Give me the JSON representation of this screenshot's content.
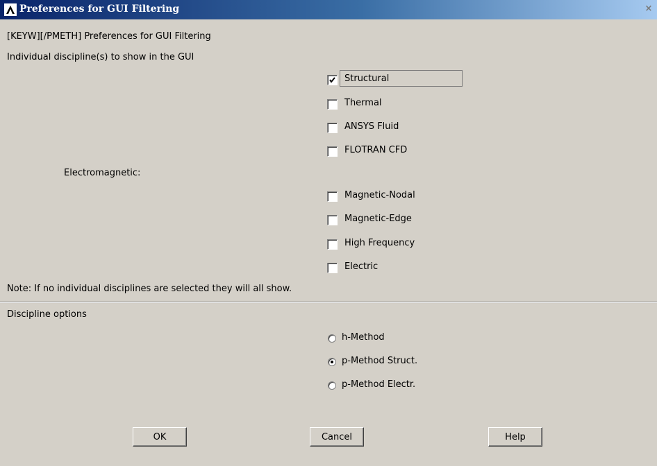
{
  "window": {
    "title": "Preferences for GUI Filtering",
    "close_glyph": "×",
    "logo_icon": "ansys-logo-icon"
  },
  "header": {
    "command": "[KEYW][/PMETH] Preferences for GUI Filtering",
    "section_label": "Individual discipline(s) to show in the GUI"
  },
  "disciplines": [
    {
      "label": "Structural",
      "checked": true
    },
    {
      "label": "Thermal",
      "checked": false
    },
    {
      "label": "ANSYS Fluid",
      "checked": false
    },
    {
      "label": "FLOTRAN CFD",
      "checked": false
    }
  ],
  "electromagnetic": {
    "label": "Electromagnetic:",
    "items": [
      {
        "label": "Magnetic-Nodal",
        "checked": false
      },
      {
        "label": "Magnetic-Edge",
        "checked": false
      },
      {
        "label": "High Frequency",
        "checked": false
      },
      {
        "label": "Electric",
        "checked": false
      }
    ]
  },
  "note": "Note: If no individual disciplines are selected they will all show.",
  "options": {
    "label": "Discipline options",
    "methods": [
      {
        "label": "h-Method",
        "selected": false
      },
      {
        "label": "p-Method Struct.",
        "selected": true
      },
      {
        "label": "p-Method Electr.",
        "selected": false
      }
    ]
  },
  "buttons": {
    "ok": "OK",
    "cancel": "Cancel",
    "help": "Help"
  }
}
